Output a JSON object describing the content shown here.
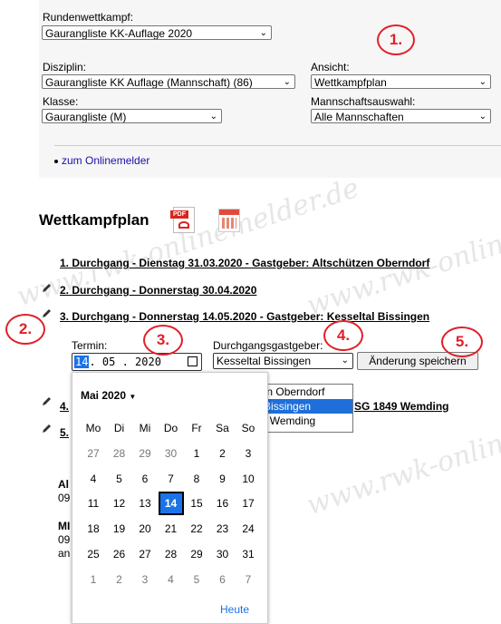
{
  "filters": {
    "rundenwettkampf_label": "Rundenwettkampf:",
    "rundenwettkampf_value": "Gaurangliste KK-Auflage 2020",
    "disziplin_label": "Disziplin:",
    "disziplin_value": "Gaurangliste KK Auflage (Mannschaft) (86)",
    "ansicht_label": "Ansicht:",
    "ansicht_value": "Wettkampfplan",
    "klasse_label": "Klasse:",
    "klasse_value": "Gaurangliste (M)",
    "mannschaft_label": "Mannschaftsauswahl:",
    "mannschaft_value": "Alle Mannschaften",
    "online_link": "zum Onlinemelder"
  },
  "main": {
    "heading": "Wettkampfplan",
    "pdf_icon_text": "PDF"
  },
  "durchgaenge": [
    {
      "label": "1. Durchgang - Dienstag 31.03.2020 - Gastgeber: Altschützen Oberndorf"
    },
    {
      "label": "2. Durchgang - Donnerstag 30.04.2020"
    },
    {
      "label": "3. Durchgang - Donnerstag 14.05.2020 - Gastgeber: Kesseltal Bissingen"
    },
    {
      "label_left": "4.",
      "label_right": "SG 1849 Wemding"
    },
    {
      "label_left": "5."
    }
  ],
  "edit_form": {
    "termin_label": "Termin:",
    "termin_day": "14",
    "termin_rest": ". 05 . 2020",
    "gastgeber_label": "Durchgangsgastgeber:",
    "gastgeber_value": "Kesseltal Bissingen",
    "save_button": "Änderung speichern",
    "gastgeber_options": [
      "Altschützen Oberndorf",
      "Kesseltal Bissingen",
      "VSG 1849 Wemding"
    ]
  },
  "calendar": {
    "month_label": "Mai 2020",
    "weekdays": [
      "Mo",
      "Di",
      "Mi",
      "Do",
      "Fr",
      "Sa",
      "So"
    ],
    "weeks": [
      [
        "27",
        "28",
        "29",
        "30",
        "1",
        "2",
        "3"
      ],
      [
        "4",
        "5",
        "6",
        "7",
        "8",
        "9",
        "10"
      ],
      [
        "11",
        "12",
        "13",
        "14",
        "15",
        "16",
        "17"
      ],
      [
        "18",
        "19",
        "20",
        "21",
        "22",
        "23",
        "24"
      ],
      [
        "25",
        "26",
        "27",
        "28",
        "29",
        "30",
        "31"
      ],
      [
        "1",
        "2",
        "3",
        "4",
        "5",
        "6",
        "7"
      ]
    ],
    "selected": "14",
    "today_button": "Heute"
  },
  "background_text": {
    "frag1": "Al",
    "frag2": "09",
    "frag3": "MI",
    "frag4": "09",
    "frag5": "an"
  },
  "callouts": [
    "1.",
    "2.",
    "3.",
    "4.",
    "5."
  ],
  "watermark": "www.rwk-onlinemelder.de",
  "colors": {
    "callout": "#e0202a",
    "selected_day": "#1a73e8",
    "dropdown_highlight": "#1e6fd9"
  }
}
